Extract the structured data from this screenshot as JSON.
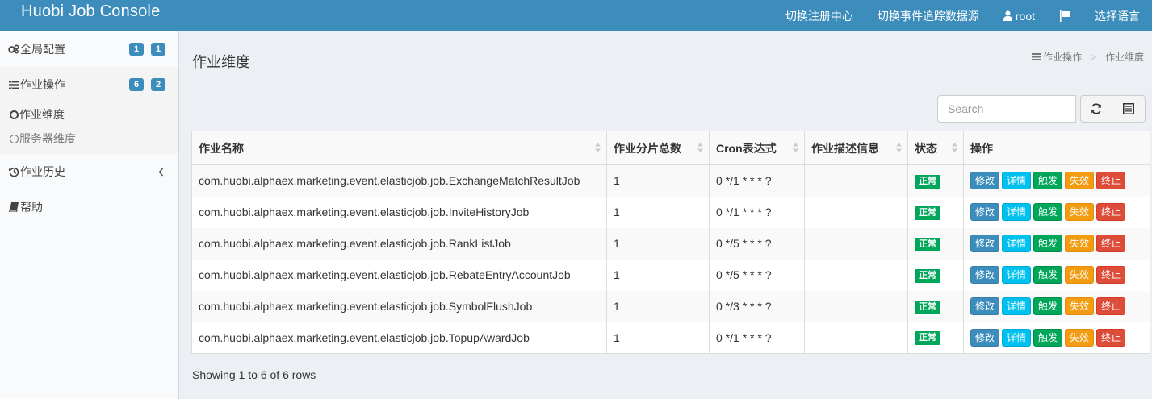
{
  "header": {
    "brand": "Huobi Job Console",
    "nav": {
      "registry": "切换注册中心",
      "datasource": "切换事件追踪数据源",
      "user": "root",
      "language": "选择语言"
    }
  },
  "sidebar": {
    "global_config": {
      "label": "全局配置",
      "badges": [
        "1",
        "1"
      ]
    },
    "job_ops": {
      "label": "作业操作",
      "badges": [
        "6",
        "2"
      ]
    },
    "job_dimension": "作业维度",
    "server_dimension": "服务器维度",
    "job_history": "作业历史",
    "help": "帮助"
  },
  "main": {
    "title": "作业维度",
    "breadcrumb": {
      "parent": "作业操作",
      "current": "作业维度"
    },
    "search": {
      "placeholder": "Search"
    },
    "columns": [
      "作业名称",
      "作业分片总数",
      "Cron表达式",
      "作业描述信息",
      "状态",
      "操作"
    ],
    "rows": [
      {
        "name": "com.huobi.alphaex.marketing.event.elasticjob.job.ExchangeMatchResultJob",
        "shards": "1",
        "cron": "0 */1 * * * ?",
        "desc": "",
        "status": "正常"
      },
      {
        "name": "com.huobi.alphaex.marketing.event.elasticjob.job.InviteHistoryJob",
        "shards": "1",
        "cron": "0 */1 * * * ?",
        "desc": "",
        "status": "正常"
      },
      {
        "name": "com.huobi.alphaex.marketing.event.elasticjob.job.RankListJob",
        "shards": "1",
        "cron": "0 */5 * * * ?",
        "desc": "",
        "status": "正常"
      },
      {
        "name": "com.huobi.alphaex.marketing.event.elasticjob.job.RebateEntryAccountJob",
        "shards": "1",
        "cron": "0 */5 * * * ?",
        "desc": "",
        "status": "正常"
      },
      {
        "name": "com.huobi.alphaex.marketing.event.elasticjob.job.SymbolFlushJob",
        "shards": "1",
        "cron": "0 */3 * * * ?",
        "desc": "",
        "status": "正常"
      },
      {
        "name": "com.huobi.alphaex.marketing.event.elasticjob.job.TopupAwardJob",
        "shards": "1",
        "cron": "0 */1 * * * ?",
        "desc": "",
        "status": "正常"
      }
    ],
    "actions": {
      "edit": "修改",
      "detail": "详情",
      "trigger": "触发",
      "disable": "失效",
      "shutdown": "终止"
    },
    "pagination_info": "Showing 1 to 6 of 6 rows"
  },
  "colors": {
    "header": "#3c8dbc",
    "status_ok": "#00a65a",
    "edit": "#3c8dbc",
    "detail": "#00c0ef",
    "trigger": "#00a65a",
    "disable": "#f39c12",
    "shutdown": "#dd4b39"
  },
  "icons": {
    "user": "user-icon",
    "language": "flag-icon",
    "global_config": "gears-icon",
    "job_ops": "tasks-icon",
    "dimension": "circle-icon",
    "history": "history-icon",
    "help": "book-icon",
    "refresh": "refresh-icon",
    "columns": "columns-icon",
    "sort": "sort-icon"
  }
}
